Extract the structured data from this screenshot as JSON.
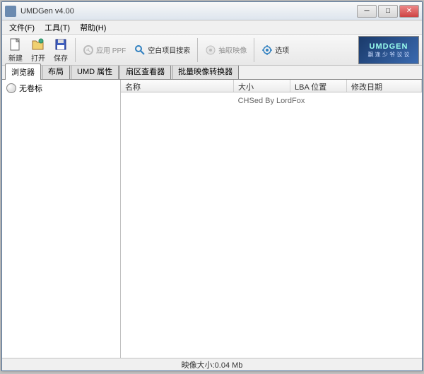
{
  "window": {
    "title": "UMDGen v4.00"
  },
  "menu": {
    "file": "文件(F)",
    "tools": "工具(T)",
    "help": "帮助(H)"
  },
  "toolbar": {
    "new": "新建",
    "open": "打开",
    "save": "保存",
    "apply_ppf": "应用 PPF",
    "blank_search": "空白项目搜索",
    "extract_image": "抽取映像",
    "options": "选项"
  },
  "logo": {
    "title": "UMDGEN",
    "subtitle": "飘 逢 少 爷 议 议"
  },
  "tabs": {
    "browser": "浏览器",
    "layout": "布局",
    "umd_props": "UMD 属性",
    "sector_viewer": "扇区查看器",
    "batch_converter": "批量映像转换器"
  },
  "tree": {
    "root": "无卷标"
  },
  "columns": {
    "name": "名称",
    "size": "大小",
    "lba": "LBA 位置",
    "date": "修改日期"
  },
  "watermark": "CHSed By LordFox",
  "status": {
    "image_size": "映像大小:0.04 Mb"
  }
}
